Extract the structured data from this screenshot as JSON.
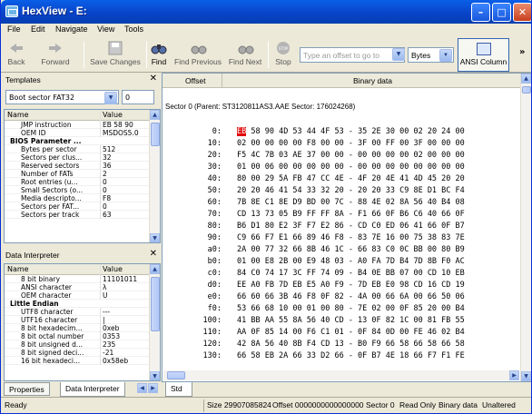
{
  "window": {
    "title": "HexView - E:"
  },
  "menu": [
    "File",
    "Edit",
    "Navigate",
    "View",
    "Tools"
  ],
  "toolbar": {
    "back": "Back",
    "forward": "Forward",
    "save": "Save Changes",
    "find": "Find",
    "find_prev": "Find Previous",
    "find_next": "Find Next",
    "stop": "Stop",
    "offset_placeholder": "Type an offset to go to",
    "unit": "Bytes",
    "ansi": "ANSI Column"
  },
  "templates": {
    "title": "Templates",
    "template": "Boot sector FAT32",
    "index": "0",
    "col_name": "Name",
    "col_value": "Value",
    "rows": [
      {
        "name": "JMP instruction",
        "value": "EB 58 90"
      },
      {
        "name": "OEM ID",
        "value": "MSDOS5.0"
      },
      {
        "name": "BIOS Parameter ...",
        "value": "",
        "group": true
      },
      {
        "name": "Bytes per sector",
        "value": "512"
      },
      {
        "name": "Sectors per clus...",
        "value": "32"
      },
      {
        "name": "Reserved sectors",
        "value": "36"
      },
      {
        "name": "Number of FATs",
        "value": "2"
      },
      {
        "name": "Root entries (u...",
        "value": "0"
      },
      {
        "name": "Small Sectors (o...",
        "value": "0"
      },
      {
        "name": "Media descripto...",
        "value": "F8"
      },
      {
        "name": "Sectors per FAT...",
        "value": "0"
      },
      {
        "name": "Sectors per track",
        "value": "63"
      }
    ]
  },
  "interpreter": {
    "title": "Data Interpreter",
    "col_name": "Name",
    "col_value": "Value",
    "rows": [
      {
        "name": "8 bit binary",
        "value": "11101011"
      },
      {
        "name": "ANSI character",
        "value": "λ"
      },
      {
        "name": "OEM character",
        "value": "U"
      },
      {
        "name": "Little Endian",
        "value": "",
        "group": true
      },
      {
        "name": "UTF8 character",
        "value": "---"
      },
      {
        "name": "UTF16 character",
        "value": "|"
      },
      {
        "name": "8 bit hexadecim...",
        "value": "0xeb"
      },
      {
        "name": "8 bit octal number",
        "value": "0353"
      },
      {
        "name": "8 bit unsigned d...",
        "value": "235"
      },
      {
        "name": "8 bit signed deci...",
        "value": "-21"
      },
      {
        "name": "16 bit hexadeci...",
        "value": "0x58eb"
      }
    ]
  },
  "left_tabs": [
    "Properties",
    "Data Interpreter"
  ],
  "hex": {
    "col_offset": "Offset",
    "col_binary": "Binary data",
    "sector_line": "Sector 0 (Parent: ST3120811AS3.AAE Sector: 176024268)",
    "rows": [
      {
        "off": "0:",
        "bytes": "EB 58 90 4D 53 44 4F 53 - 35 2E 30 00 02 20 24 00"
      },
      {
        "off": "10:",
        "bytes": "02 00 00 00 00 F8 00 00 - 3F 00 FF 00 3F 00 00 00"
      },
      {
        "off": "20:",
        "bytes": "F5 4C 7B 03 AE 37 00 00 - 00 00 00 00 02 00 00 00"
      },
      {
        "off": "30:",
        "bytes": "01 00 06 00 00 00 00 00 - 00 00 00 00 00 00 00 00"
      },
      {
        "off": "40:",
        "bytes": "80 00 29 5A FB 47 CC 4E - 4F 20 4E 41 4D 45 20 20"
      },
      {
        "off": "50:",
        "bytes": "20 20 46 41 54 33 32 20 - 20 20 33 C9 8E D1 BC F4"
      },
      {
        "off": "60:",
        "bytes": "7B 8E C1 8E D9 BD 00 7C - 88 4E 02 8A 56 40 B4 08"
      },
      {
        "off": "70:",
        "bytes": "CD 13 73 05 B9 FF FF 8A - F1 66 0F B6 C6 40 66 0F"
      },
      {
        "off": "80:",
        "bytes": "B6 D1 80 E2 3F F7 E2 86 - CD C0 ED 06 41 66 0F B7"
      },
      {
        "off": "90:",
        "bytes": "C9 66 F7 E1 66 89 46 F8 - 83 7E 16 00 75 38 83 7E"
      },
      {
        "off": "a0:",
        "bytes": "2A 00 77 32 66 8B 46 1C - 66 83 C0 0C BB 00 80 B9"
      },
      {
        "off": "b0:",
        "bytes": "01 00 E8 2B 00 E9 48 03 - A0 FA 7D B4 7D 8B F0 AC"
      },
      {
        "off": "c0:",
        "bytes": "84 C0 74 17 3C FF 74 09 - B4 0E BB 07 00 CD 10 EB"
      },
      {
        "off": "d0:",
        "bytes": "EE A0 FB 7D EB E5 A0 F9 - 7D EB E0 98 CD 16 CD 19"
      },
      {
        "off": "e0:",
        "bytes": "66 60 66 3B 46 F8 0F 82 - 4A 00 66 6A 00 66 50 06"
      },
      {
        "off": "f0:",
        "bytes": "53 66 68 10 00 01 00 80 - 7E 02 00 0F 85 20 00 B4"
      },
      {
        "off": "100:",
        "bytes": "41 BB AA 55 8A 56 40 CD - 13 0F 82 1C 00 81 FB 55"
      },
      {
        "off": "110:",
        "bytes": "AA 0F 85 14 00 F6 C1 01 - 0F 84 0D 00 FE 46 02 B4"
      },
      {
        "off": "120:",
        "bytes": "42 8A 56 40 8B F4 CD 13 - B0 F9 66 58 66 58 66 58"
      },
      {
        "off": "130:",
        "bytes": "66 58 EB 2A 66 33 D2 66 - 0F B7 4E 18 66 F7 F1 FE"
      }
    ],
    "highlight_first": "EB"
  },
  "bottom_tab": "Std",
  "status": {
    "ready": "Ready",
    "size": "Size 29907085824",
    "offset": "Offset 0000000000000000",
    "sector": "Sector 0",
    "mode": "Read Only",
    "kind": "Binary data",
    "state": "Unaltered"
  }
}
